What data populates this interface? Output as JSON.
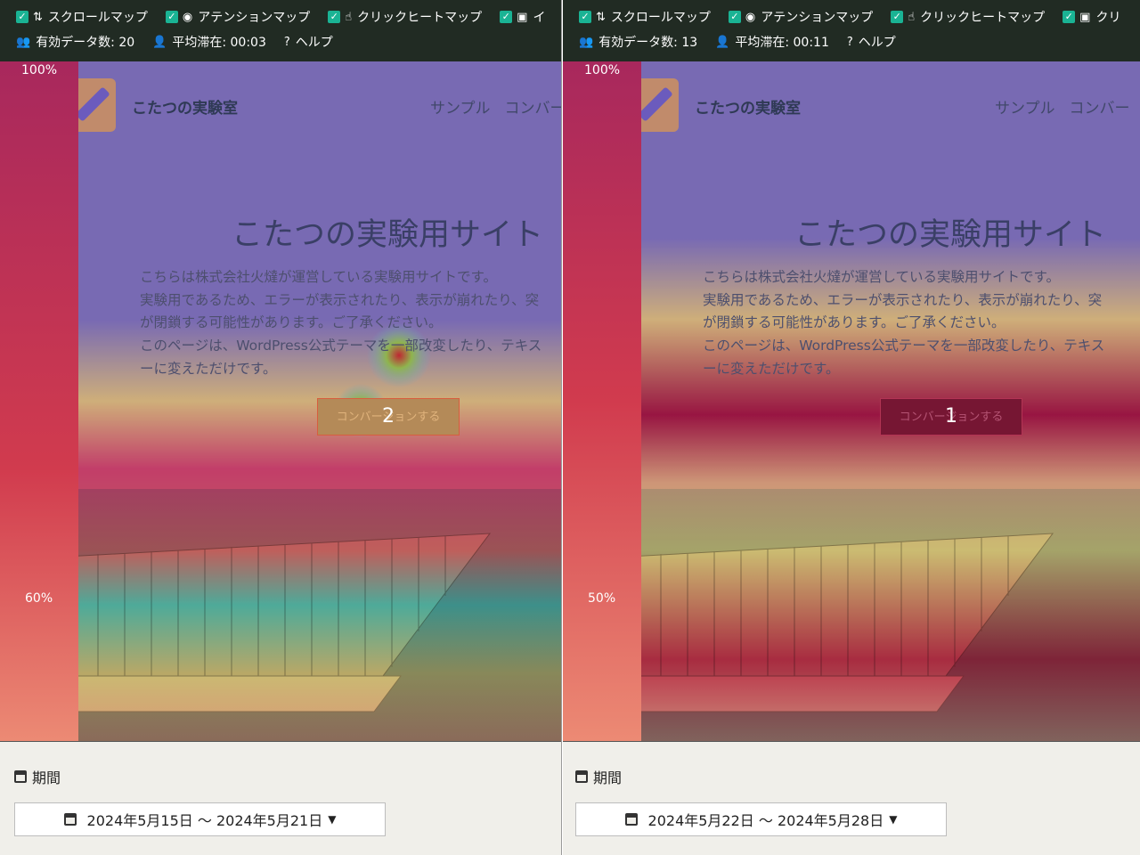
{
  "left": {
    "toolbar": {
      "options": [
        {
          "label": "スクロールマップ",
          "icon": "scroll-icon"
        },
        {
          "label": "アテンションマップ",
          "icon": "eye-icon"
        },
        {
          "label": "クリックヒートマップ",
          "icon": "click-icon"
        },
        {
          "label": "イ",
          "icon": "image-icon"
        }
      ],
      "valid_data_label": "有効データ数: 20",
      "avg_stay_label": "平均滞在: 00:03",
      "help_label": "ヘルプ"
    },
    "scroll_markers": {
      "top": "100%",
      "mid": "60%"
    },
    "click_count": "2",
    "period_label": "期間",
    "date_range": "2024年5月15日 ～ 2024年5月21日"
  },
  "right": {
    "toolbar": {
      "options": [
        {
          "label": "スクロールマップ",
          "icon": "scroll-icon"
        },
        {
          "label": "アテンションマップ",
          "icon": "eye-icon"
        },
        {
          "label": "クリックヒートマップ",
          "icon": "click-icon"
        },
        {
          "label": "クリ",
          "icon": "image-icon"
        }
      ],
      "valid_data_label": "有効データ数: 13",
      "avg_stay_label": "平均滞在: 00:11",
      "help_label": "ヘルプ"
    },
    "scroll_markers": {
      "top": "100%",
      "mid": "50%"
    },
    "click_count": "1",
    "period_label": "期間",
    "date_range": "2024年5月22日 ～ 2024年5月28日"
  },
  "site": {
    "name": "こたつの実験室",
    "nav": [
      "サンプル",
      "コンバー"
    ],
    "hero_title": "こたつの実験用サイト",
    "paragraph": [
      "こちらは株式会社火燵が運営している実験用サイトです。",
      "実験用であるため、エラーが表示されたり、表示が崩れたり、突",
      "が閉鎖する可能性があります。ご了承ください。",
      "このページは、WordPress公式テーマを一部改変したり、テキス",
      "ーに変えただけです。"
    ],
    "cta_label": "コンバージョンする"
  },
  "colors": {
    "toolbar_bg": "#212b23",
    "checkbox": "#1ab394",
    "bottom_bg": "#f0efea"
  }
}
